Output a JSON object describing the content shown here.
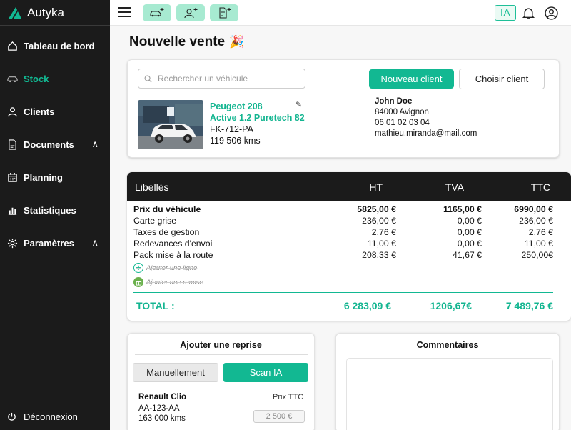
{
  "app": {
    "name": "Autyka"
  },
  "sidebar": {
    "items": [
      {
        "label": "Tableau de bord",
        "icon": "home-icon",
        "active": false
      },
      {
        "label": "Stock",
        "icon": "car-icon",
        "active": true
      },
      {
        "label": "Clients",
        "icon": "user-icon",
        "active": false
      },
      {
        "label": "Documents",
        "icon": "document-icon",
        "active": false,
        "caret": "∧"
      },
      {
        "label": "Planning",
        "icon": "calendar-icon",
        "active": false
      },
      {
        "label": "Statistiques",
        "icon": "chart-icon",
        "active": false
      },
      {
        "label": "Paramètres",
        "icon": "gear-icon",
        "active": false,
        "caret": "∧"
      }
    ],
    "logout": "Déconnexion"
  },
  "topbar": {
    "ia_label": "IA"
  },
  "page": {
    "title": "Nouvelle vente",
    "emoji": "🎉"
  },
  "vehicle_card": {
    "search_placeholder": "Rechercher un véhicule",
    "new_client": "Nouveau client",
    "choose_client": "Choisir client",
    "car": {
      "name_line1": "Peugeot 208",
      "name_line2": "Active 1.2 Puretech 82",
      "plate": "FK-712-PA",
      "kms": "119 506 kms"
    },
    "client": {
      "name": "John Doe",
      "city": "84000 Avignon",
      "phone": "06 01 02 03 04",
      "email": "mathieu.miranda@mail.com"
    }
  },
  "price_table": {
    "headers": {
      "label": "Libellés",
      "ht": "HT",
      "tva": "TVA",
      "ttc": "TTC"
    },
    "rows": [
      {
        "label": "Prix du véhicule",
        "ht": "5825,00 €",
        "tva": "1165,00 €",
        "ttc": "6990,00 €"
      },
      {
        "label": "Carte grise",
        "ht": "236,00 €",
        "tva": "0,00 €",
        "ttc": "236,00 €"
      },
      {
        "label": "Taxes de gestion",
        "ht": "2,76 €",
        "tva": "0,00 €",
        "ttc": "2,76 €"
      },
      {
        "label": "Redevances d'envoi",
        "ht": "11,00 €",
        "tva": "0,00 €",
        "ttc": "11,00 €"
      },
      {
        "label": "Pack mise à la route",
        "ht": "208,33 €",
        "tva": "41,67 €",
        "ttc": "250,00€"
      }
    ],
    "add_line": "Ajouter une ligne",
    "add_discount": "Ajouter une remise",
    "total": {
      "label": "TOTAL :",
      "ht": "6 283,09 €",
      "tva": "1206,67€",
      "ttc": "7 489,76 €"
    }
  },
  "trade_in": {
    "title": "Ajouter une reprise",
    "manual": "Manuellement",
    "scan": "Scan IA",
    "car_name": "Renault Clio",
    "price_label": "Prix TTC",
    "plate": "AA-123-AA",
    "kms": "163 000 kms",
    "price": "2 500 €"
  },
  "comments": {
    "title": "Commentaires"
  },
  "colors": {
    "accent": "#12b892",
    "sidebar": "#1b1b1b",
    "quick_btn": "#a7ead1"
  }
}
